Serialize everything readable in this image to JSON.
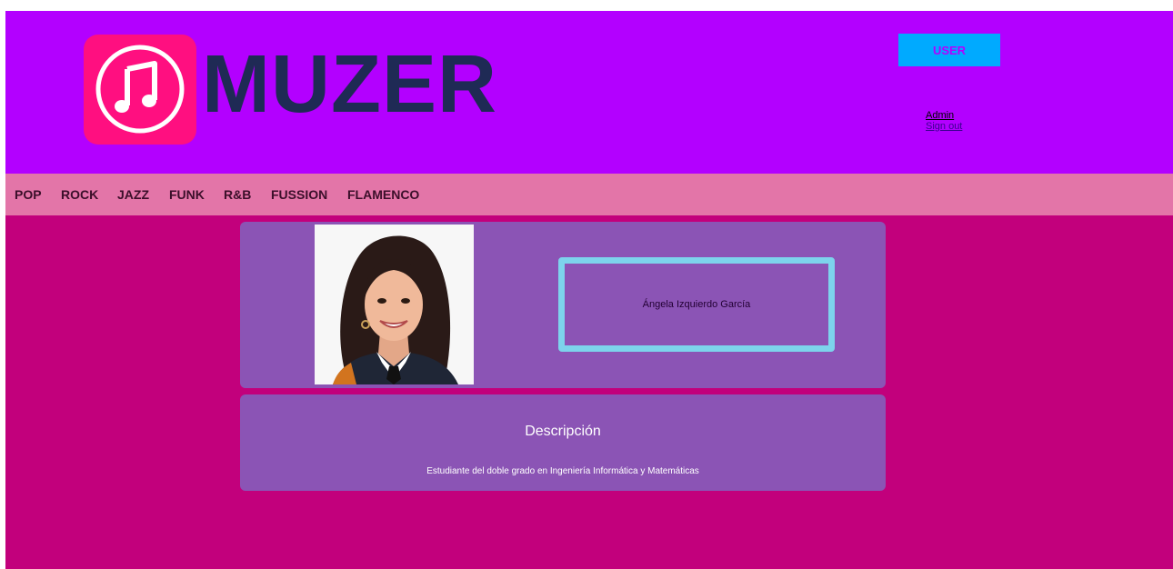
{
  "brand": {
    "name": "MUZER",
    "logo_icon": "music-note-icon"
  },
  "user_menu": {
    "button_label": "USER",
    "links": [
      "Admin",
      "Sign out"
    ]
  },
  "nav": {
    "items": [
      "POP",
      "ROCK",
      "JAZZ",
      "FUNK",
      "R&B",
      "FUSSION",
      "FLAMENCO"
    ]
  },
  "profile": {
    "name": "Ángela Izquierdo García",
    "photo_icon": "profile-photo"
  },
  "description": {
    "title": "Descripción",
    "text": "Estudiante del doble grado en Ingeniería Informática y Matemáticas"
  },
  "colors": {
    "page_background": "#c2007c",
    "header_background": "#b300ff",
    "nav_background": "#e375a8",
    "card_background": "#8b54b5",
    "logo_background": "#ff0f80",
    "user_button": "#00aaff",
    "name_border": "#7dd3ec"
  }
}
